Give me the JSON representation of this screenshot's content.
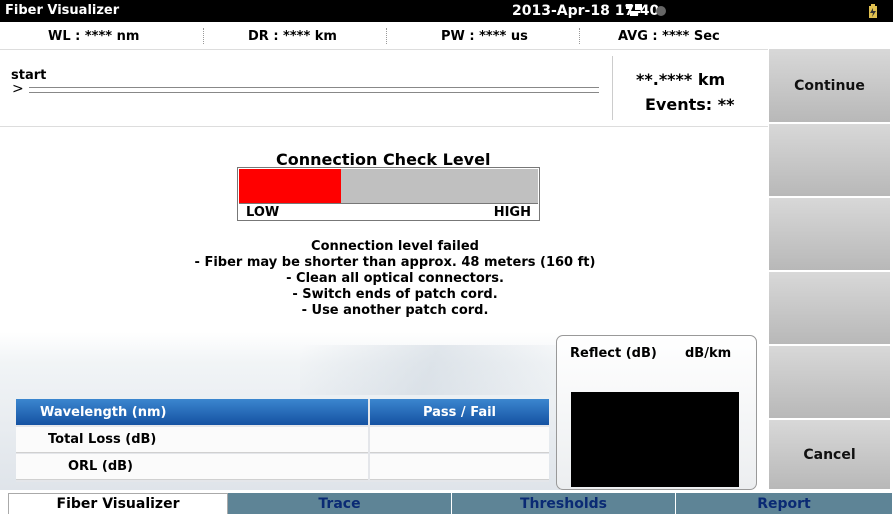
{
  "titlebar": {
    "app_title": "Fiber Visualizer",
    "datetime": "2013-Apr-18 17:40"
  },
  "params": {
    "wl": "WL : **** nm",
    "dr": "DR : **** km",
    "pw": "PW : **** us",
    "avg": "AVG : **** Sec"
  },
  "fiber": {
    "start_label": "start",
    "start_arrow": ">",
    "distance": "**.**** km",
    "events": "Events: **"
  },
  "softkeys": [
    "Continue",
    "",
    "",
    "",
    "",
    "Cancel"
  ],
  "connection_check": {
    "title": "Connection Check Level",
    "low": "LOW",
    "high": "HIGH",
    "level_fraction": 0.34
  },
  "message": [
    "Connection level failed",
    "- Fiber may be shorter than approx. 48 meters (160 ft)",
    "- Clean all optical connectors.",
    "- Switch ends of patch cord.",
    "- Use another patch cord."
  ],
  "results": {
    "header": {
      "label": "Wavelength (nm)",
      "value": "Pass / Fail"
    },
    "rows": [
      {
        "label": "Total Loss (dB)",
        "value": ""
      },
      {
        "label": "ORL (dB)",
        "value": ""
      }
    ]
  },
  "reflect": {
    "label1": "Reflect (dB)",
    "label2": "dB/km"
  },
  "tabs": [
    "Fiber Visualizer",
    "Trace",
    "Thresholds",
    "Report"
  ],
  "colors": {
    "fail_bar": "#ff0000",
    "header_blue": "#1f63b3",
    "tab_inactive": "#5e8496"
  }
}
